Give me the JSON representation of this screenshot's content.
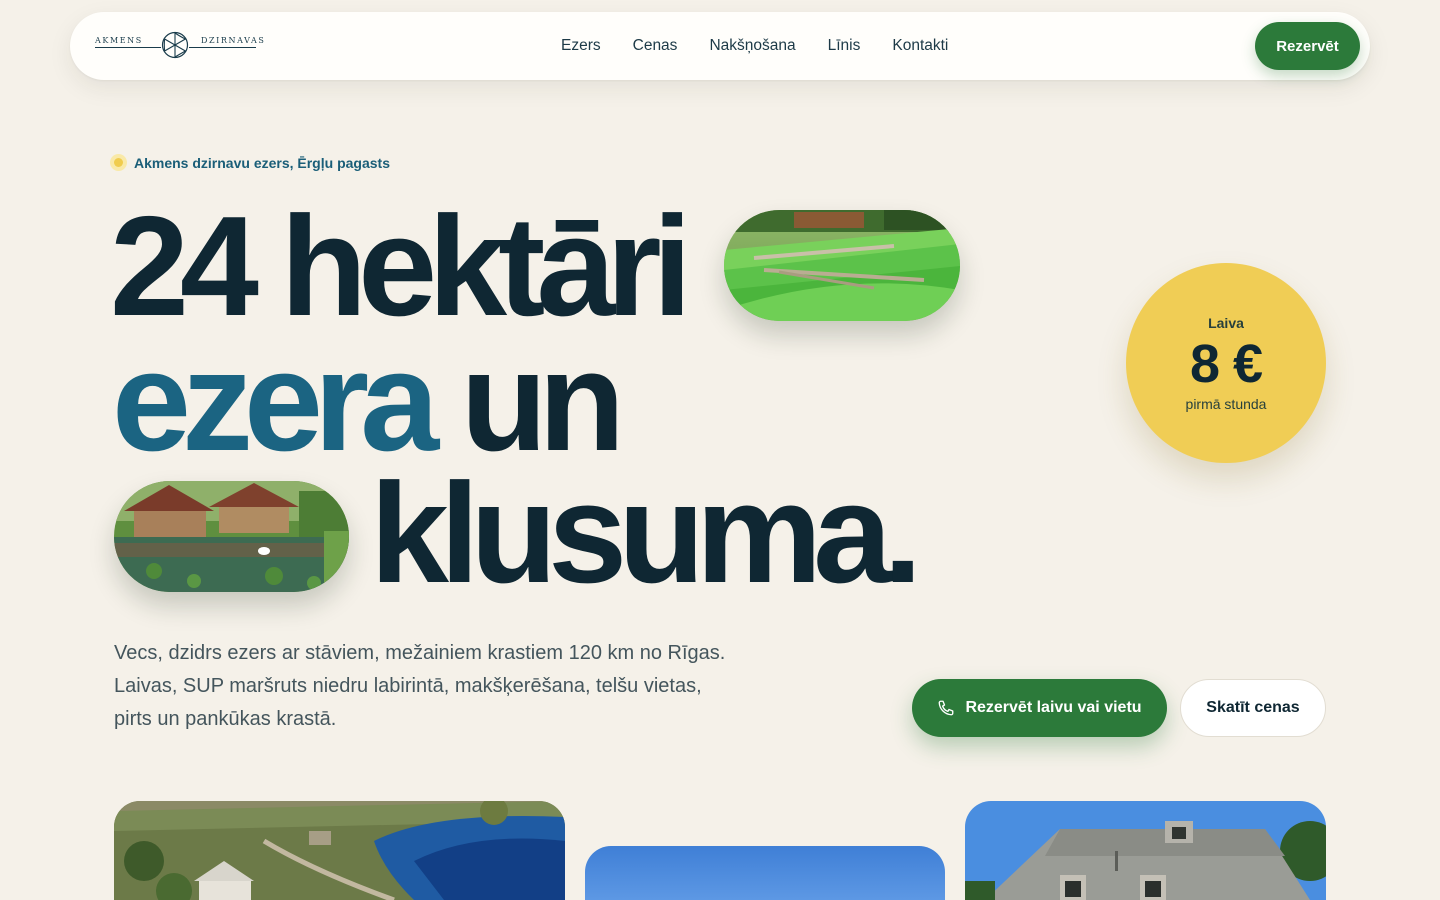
{
  "brand": {
    "logo_left": "AKMENS",
    "logo_right": "DZIRNAVAS",
    "logo_icon": "mill-wheel-icon"
  },
  "nav": {
    "links": [
      "Ezers",
      "Cenas",
      "Nakšņošana",
      "Līnis",
      "Kontakti"
    ],
    "cta": "Rezervēt"
  },
  "hero": {
    "eyebrow": "Akmens dzirnavu ezers, Ērgļu pagasts",
    "line1": "24 hektāri",
    "line2_accent": "ezera",
    "line2_rest": "un",
    "line3": "klusuma.",
    "intro_lines": [
      "Vecs, dzidrs ezers ar stāviem, mežainiem krastiem 120 km no Rīgas.",
      "Laivas, SUP maršruts niedru labirintā, makšķerēšana, telšu vietas,",
      "pirts un pankūkas krastā."
    ]
  },
  "price_badge": {
    "label": "Laiva",
    "price": "8 €",
    "sub": "pirmā stunda"
  },
  "cta": {
    "primary": "Rezervēt laivu vai vietu",
    "primary_icon": "phone-icon",
    "secondary": "Skatīt cenas"
  },
  "colors": {
    "background": "#f5f1e9",
    "primary_green": "#2c7a3a",
    "accent_blue": "#1b6482",
    "dark_text": "#0f2733",
    "badge_yellow": "#f0cd55"
  }
}
